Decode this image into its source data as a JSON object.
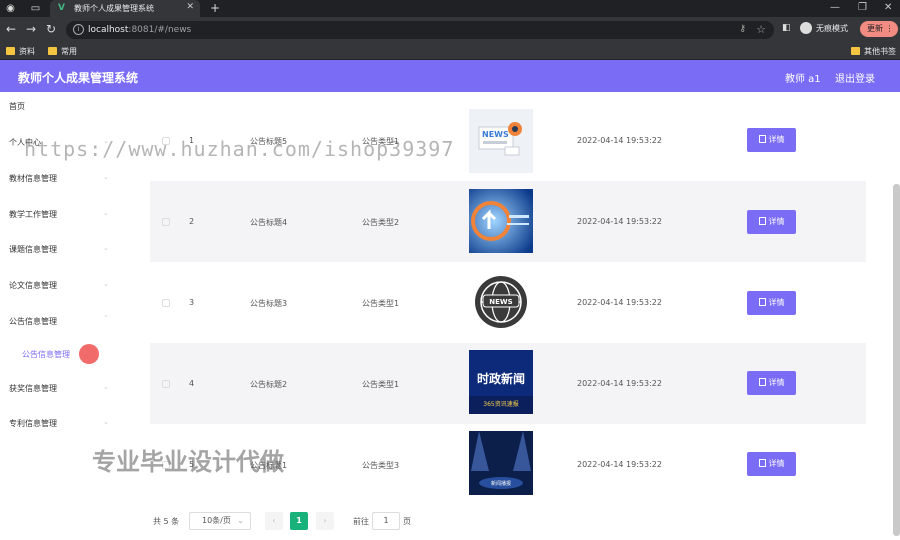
{
  "browser": {
    "tab_title": "教师个人成果管理系统",
    "url_host": "localhost",
    "url_path": ":8081/#/news",
    "incognito_label": "无痕模式",
    "update_label": "更新",
    "bookmarks": [
      "资料",
      "常用"
    ],
    "other_bookmarks": "其他书签"
  },
  "header": {
    "title": "教师个人成果管理系统",
    "user": "教师 a1",
    "logout": "退出登录"
  },
  "sidebar": {
    "items": [
      {
        "label": "首页"
      },
      {
        "label": "个人中心"
      },
      {
        "label": "教材信息管理"
      },
      {
        "label": "教学工作管理"
      },
      {
        "label": "课题信息管理"
      },
      {
        "label": "论文信息管理"
      },
      {
        "label": "公告信息管理"
      },
      {
        "label": "获奖信息管理"
      },
      {
        "label": "专利信息管理"
      }
    ],
    "active_sub": "公告信息管理"
  },
  "table": {
    "rows": [
      {
        "index": "1",
        "title": "公告标题5",
        "type": "公告类型1",
        "image": "news-image",
        "time": "2022-04-14 19:53:22",
        "action": "详情"
      },
      {
        "index": "2",
        "title": "公告标题4",
        "type": "公告类型2",
        "image": "digital-arrow-image",
        "time": "2022-04-14 19:53:22",
        "action": "详情"
      },
      {
        "index": "3",
        "title": "公告标题3",
        "type": "公告类型1",
        "image": "news-globe-image",
        "time": "2022-04-14 19:53:22",
        "action": "详情"
      },
      {
        "index": "4",
        "title": "公告标题2",
        "type": "公告类型1",
        "image": "political-news-image",
        "time": "2022-04-14 19:53:22",
        "action": "详情"
      },
      {
        "index": "5",
        "title": "公告标题1",
        "type": "公告类型3",
        "image": "spotlight-news-image",
        "time": "2022-04-14 19:53:22",
        "action": "详情"
      }
    ],
    "thumb_texts": {
      "political_title": "时政新闻",
      "political_sub": "365资讯速报",
      "news_badge": "NEWS",
      "spot_text": "新闻播报"
    }
  },
  "pager": {
    "total": "共 5 条",
    "size": "10条/页",
    "current": "1",
    "goto_label": "前往",
    "goto_value": "1",
    "page_unit": "页"
  },
  "watermarks": {
    "url": "https://www.huzhan.com/ishop39397",
    "text": "专业毕业设计代做"
  },
  "colors": {
    "accent": "#7b6cf5",
    "page_active": "#18b27a"
  }
}
